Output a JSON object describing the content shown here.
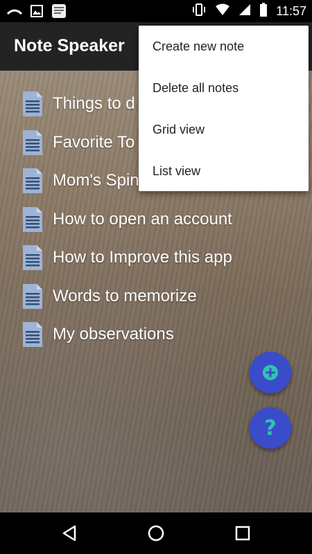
{
  "status_bar": {
    "time": "11:57",
    "icons_left": [
      "cast-icon",
      "image-icon",
      "bible-app-icon"
    ],
    "icons_right": [
      "vibrate-icon",
      "wifi-icon",
      "cellular-signal-icon",
      "battery-icon"
    ]
  },
  "app_bar": {
    "title": "Note Speaker"
  },
  "notes": [
    {
      "label": "Things to d",
      "icon": "document-icon"
    },
    {
      "label": "Favorite To",
      "icon": "document-icon"
    },
    {
      "label": "Mom's Spin",
      "icon": "document-icon"
    },
    {
      "label": "How to open an account",
      "icon": "document-icon"
    },
    {
      "label": "How to Improve this app",
      "icon": "document-icon"
    },
    {
      "label": "Words to memorize",
      "icon": "document-icon"
    },
    {
      "label": "My observations",
      "icon": "document-icon"
    }
  ],
  "menu": {
    "items": [
      {
        "label": "Create new note"
      },
      {
        "label": "Delete all notes"
      },
      {
        "label": "Grid view"
      },
      {
        "label": "List view"
      }
    ]
  },
  "fabs": {
    "add_icon": "add-circle-icon",
    "help_glyph": "?"
  },
  "nav_bar": {
    "icons": [
      "back-icon",
      "home-icon",
      "recents-icon"
    ]
  },
  "colors": {
    "fab_background": "#3b4cca",
    "fab_accent": "#2fc4b0",
    "app_bar": "#232323",
    "doc_icon": "#9fb3d4"
  }
}
